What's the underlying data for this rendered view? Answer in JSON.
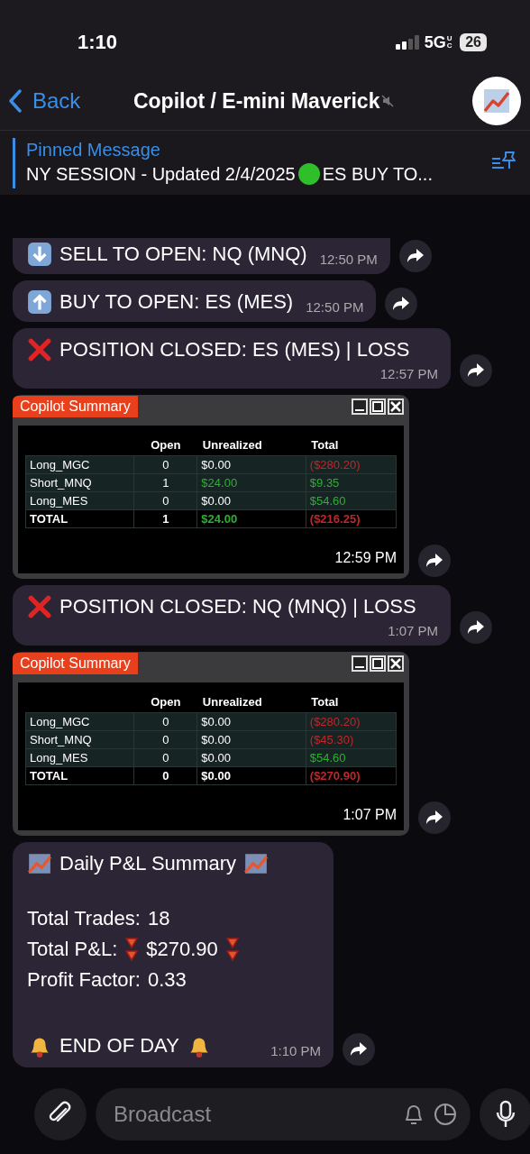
{
  "status_bar": {
    "time": "1:10",
    "network": "5G",
    "network_badge": "UC",
    "battery": "26"
  },
  "header": {
    "back": "Back",
    "title": "Copilot / E-mini Maverick",
    "muted": true
  },
  "pinned": {
    "label": "Pinned Message",
    "text": "NY SESSION - Updated 2/4/2025",
    "text_after": "ES BUY TO..."
  },
  "messages": [
    {
      "kind": "sell",
      "text": "SELL TO OPEN: NQ (MNQ)",
      "time": "12:50 PM",
      "cut_top": true
    },
    {
      "kind": "buy",
      "text": "BUY TO OPEN: ES (MES)",
      "time": "12:50 PM",
      "cut_top": false
    },
    {
      "kind": "closed",
      "text": "POSITION CLOSED: ES (MES) | LOSS",
      "time": "12:57 PM",
      "cut_top": false
    },
    {
      "kind": "summary",
      "title": "Copilot Summary",
      "time": "12:59 PM",
      "columns": [
        "",
        "Open",
        "Unrealized",
        "Total"
      ],
      "rows": [
        {
          "kind": "position",
          "cells": [
            {
              "text": "Long_MGC"
            },
            {
              "text": "0"
            },
            {
              "text": "$0.00"
            },
            {
              "text": "($280.20)",
              "color": "#c0262a"
            }
          ]
        },
        {
          "kind": "position",
          "cells": [
            {
              "text": "Short_MNQ"
            },
            {
              "text": "1"
            },
            {
              "text": "$24.00",
              "color": "#2fae34"
            },
            {
              "text": "$9.35",
              "color": "#2fae34"
            }
          ]
        },
        {
          "kind": "position",
          "cells": [
            {
              "text": "Long_MES"
            },
            {
              "text": "0"
            },
            {
              "text": "$0.00"
            },
            {
              "text": "$54.60",
              "color": "#2fae34"
            }
          ]
        },
        {
          "kind": "total",
          "cells": [
            {
              "text": "TOTAL"
            },
            {
              "text": "1"
            },
            {
              "text": "$24.00",
              "color": "#2fae34"
            },
            {
              "text": "($216.25)",
              "color": "#c0262a"
            }
          ]
        }
      ]
    },
    {
      "kind": "closed",
      "text": "POSITION CLOSED: NQ (MNQ) | LOSS",
      "time": "1:07 PM",
      "cut_top": false
    },
    {
      "kind": "summary",
      "title": "Copilot Summary",
      "time": "1:07 PM",
      "columns": [
        "",
        "Open",
        "Unrealized",
        "Total"
      ],
      "rows": [
        {
          "kind": "position",
          "cells": [
            {
              "text": "Long_MGC"
            },
            {
              "text": "0"
            },
            {
              "text": "$0.00"
            },
            {
              "text": "($280.20)",
              "color": "#c0262a"
            }
          ]
        },
        {
          "kind": "position",
          "cells": [
            {
              "text": "Short_MNQ"
            },
            {
              "text": "0"
            },
            {
              "text": "$0.00"
            },
            {
              "text": "($45.30)",
              "color": "#c0262a"
            }
          ]
        },
        {
          "kind": "position",
          "cells": [
            {
              "text": "Long_MES"
            },
            {
              "text": "0"
            },
            {
              "text": "$0.00"
            },
            {
              "text": "$54.60",
              "color": "#2fae34"
            }
          ]
        },
        {
          "kind": "total",
          "cells": [
            {
              "text": "TOTAL"
            },
            {
              "text": "0"
            },
            {
              "text": "$0.00"
            },
            {
              "text": "($270.90)",
              "color": "#c0262a"
            }
          ]
        }
      ]
    },
    {
      "kind": "report",
      "title": "Daily P&L Summary",
      "time": "1:10 PM",
      "stats": [
        {
          "kind": "plain",
          "label": "Total Trades:",
          "value": "18"
        },
        {
          "kind": "loss",
          "label": "Total P&L:",
          "value": "$270.90"
        },
        {
          "kind": "plain",
          "label": "Profit Factor:",
          "value": "0.33"
        }
      ],
      "footer": "END OF DAY"
    }
  ],
  "composer": {
    "placeholder": "Broadcast"
  }
}
